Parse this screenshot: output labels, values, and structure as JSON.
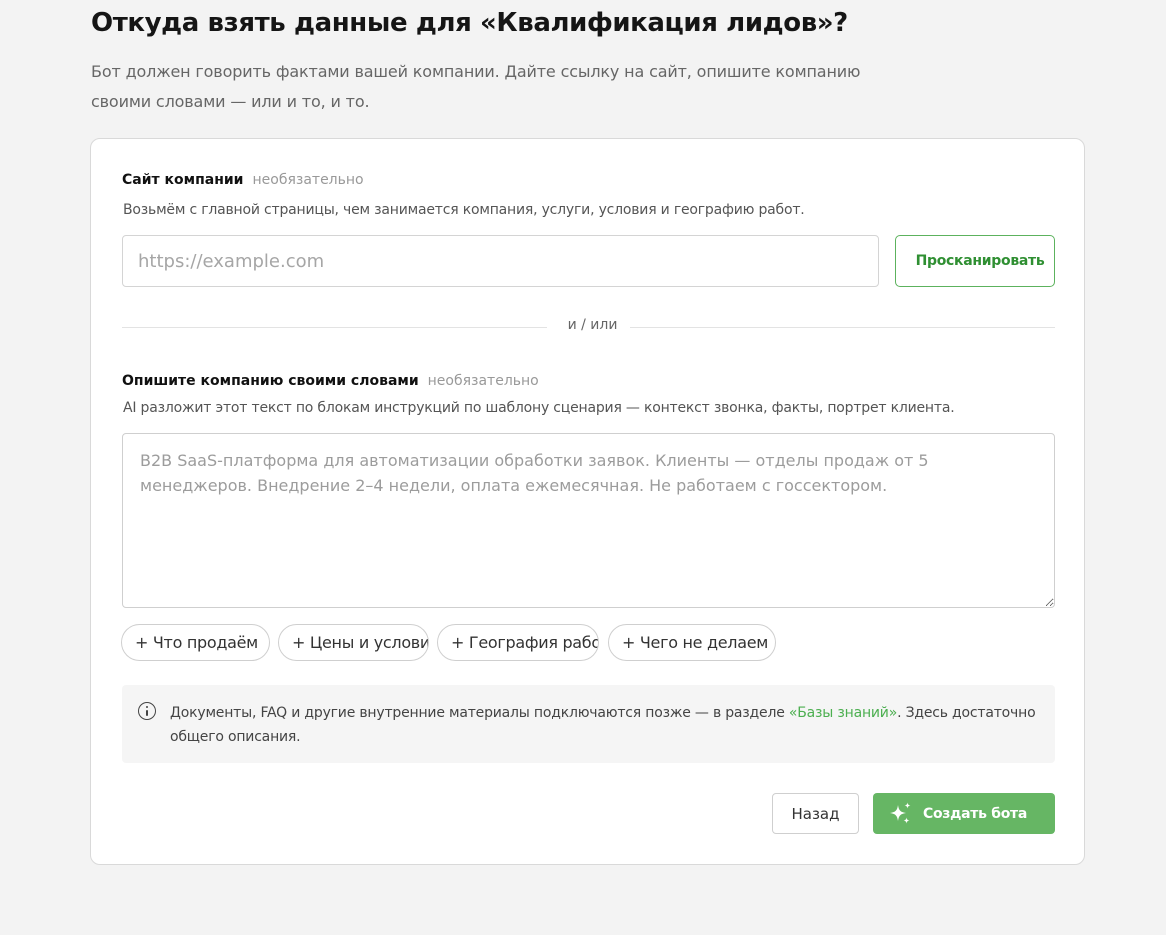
{
  "header": {
    "title": "Откуда взять данные для «Квалификация лидов»?",
    "subtitle": "Бот должен говорить фактами вашей компании. Дайте ссылку на сайт, опишите компанию своими словами — или и то, и то."
  },
  "site": {
    "label": "Сайт компании",
    "optional": "необязательно",
    "help": "Возьмём с главной страницы, чем занимается компания, услуги, условия и географию работ.",
    "url_value": "",
    "url_placeholder": "https://example.com",
    "scan_label": "Просканировать"
  },
  "divider": {
    "text": "и / или"
  },
  "description": {
    "label": "Опишите компанию своими словами",
    "optional": "необязательно",
    "help": "AI разложит этот текст по блокам инструкций по шаблону сценария — контекст звонка, факты, портрет клиента.",
    "value": "",
    "placeholder": "B2B SaaS-платформа для автоматизации обработки заявок. Клиенты — отделы продаж от 5 менеджеров. Внедрение 2–4 недели, оплата ежемесячная. Не работаем с госсектором."
  },
  "chips": [
    {
      "label": "+ Что продаём"
    },
    {
      "label": "+ Цены и условия"
    },
    {
      "label": "+ География работ"
    },
    {
      "label": "+ Чего не делаем"
    }
  ],
  "info": {
    "icon": "info-icon",
    "text_before": "Документы, FAQ и другие внутренние материалы подключаются позже — в разделе ",
    "link": "«Базы знаний»",
    "text_after": ". Здесь достаточно общего описания."
  },
  "actions": {
    "back_label": "Назад",
    "create_label": "Создать бота",
    "create_icon": "sparkle-icon"
  },
  "colors": {
    "accent": "#66b664",
    "accent_text": "#2f8f32",
    "link": "#4caf50",
    "background": "#f3f3f3"
  }
}
